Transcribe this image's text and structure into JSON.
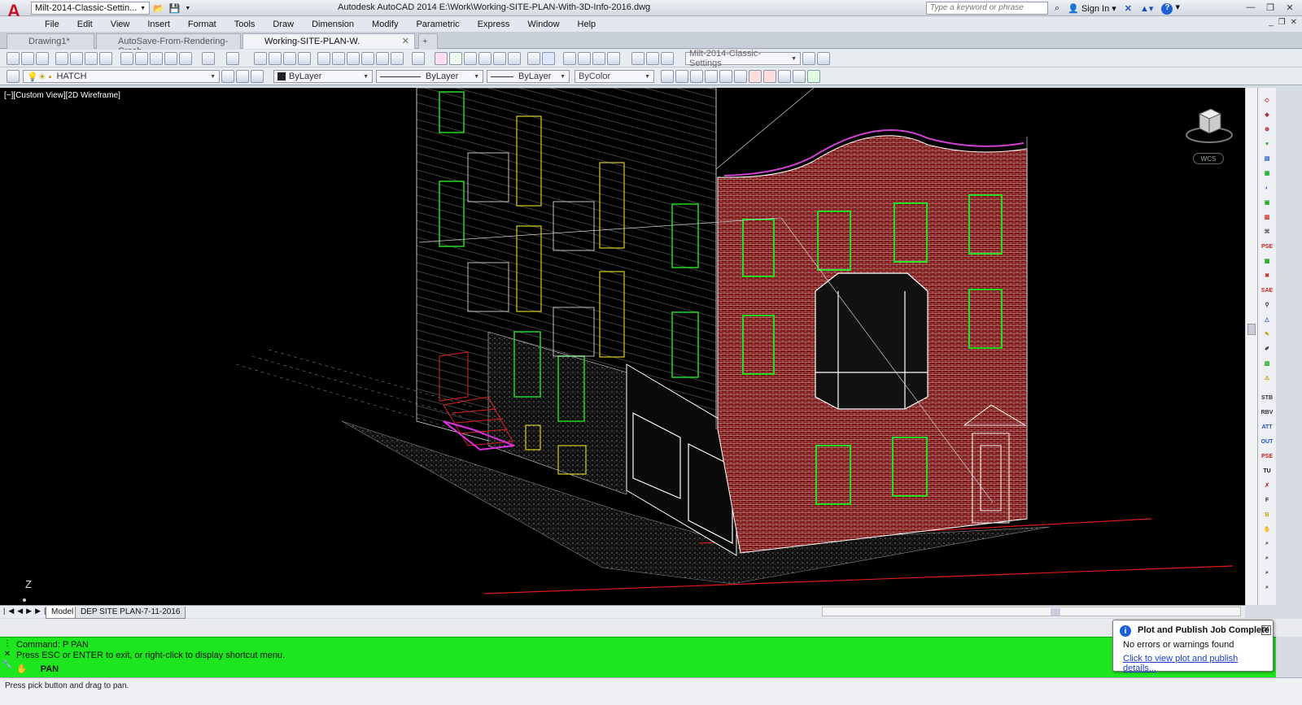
{
  "app": {
    "title": "Autodesk AutoCAD 2014    E:\\Work\\Working-SITE-PLAN-With-3D-Info-2016.dwg",
    "workspace": "Milt-2014-Classic-Settin...",
    "search_placeholder": "Type a keyword or phrase",
    "sign_in": "Sign In",
    "help": "?"
  },
  "menu": [
    "File",
    "Edit",
    "View",
    "Insert",
    "Format",
    "Tools",
    "Draw",
    "Dimension",
    "Modify",
    "Parametric",
    "Express",
    "Window",
    "Help"
  ],
  "tabs": [
    {
      "label": "Drawing1*"
    },
    {
      "label": "AutoSave-From-Rendering-Crash"
    },
    {
      "label": "Working-SITE-PLAN-W."
    }
  ],
  "toolbar": {
    "workspace_select": "Milt-2014-Classic-Settings",
    "layer": "HATCH",
    "color": "ByLayer",
    "linetype": "ByLayer",
    "lineweight": "ByLayer",
    "plotstyle": "ByColor"
  },
  "viewport": {
    "label": "[−][Custom View][2D Wireframe]",
    "wcs": "WCS",
    "axis_z": "Z"
  },
  "layouts": {
    "model": "Model",
    "layout1": "DEP SITE PLAN-7-11-2016"
  },
  "command": {
    "line1": "Command: P PAN",
    "line2": "Press ESC or ENTER to exit, or right-click to display shortcut menu.",
    "input": "PAN"
  },
  "status": {
    "prompt": "Press pick button and drag to pan."
  },
  "notification": {
    "title": "Plot and Publish Job Complete",
    "message": "No errors or warnings found",
    "link": "Click to view plot and publish details..."
  }
}
